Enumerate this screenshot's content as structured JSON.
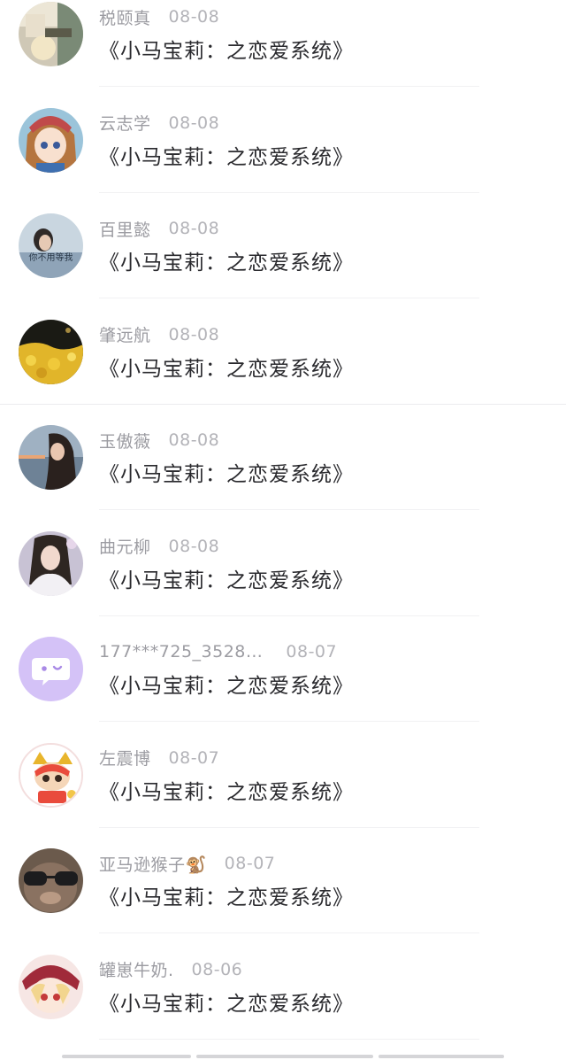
{
  "comments": [
    {
      "name": "税颐真",
      "date": "08-08",
      "content": "《小马宝莉：之恋爱系统》"
    },
    {
      "name": "云志学",
      "date": "08-08",
      "content": "《小马宝莉：之恋爱系统》"
    },
    {
      "name": "百里懿",
      "date": "08-08",
      "content": "《小马宝莉：之恋爱系统》"
    },
    {
      "name": "肇远航",
      "date": "08-08",
      "content": "《小马宝莉：之恋爱系统》"
    },
    {
      "name": "玉傲薇",
      "date": "08-08",
      "content": "《小马宝莉：之恋爱系统》"
    },
    {
      "name": "曲元柳",
      "date": "08-08",
      "content": "《小马宝莉：之恋爱系统》"
    },
    {
      "name": "177***725_3528…",
      "date": "08-07",
      "content": "《小马宝莉：之恋爱系统》"
    },
    {
      "name": "左震博",
      "date": "08-07",
      "content": "《小马宝莉：之恋爱系统》"
    },
    {
      "name": "亚马逊猴子🐒",
      "date": "08-07",
      "content": "《小马宝莉：之恋爱系统》"
    },
    {
      "name": "罐崽牛奶.",
      "date": "08-06",
      "content": "《小马宝莉：之恋爱系统》"
    }
  ],
  "avatar_text": "你不用等我",
  "colors": {
    "name": "#9c9ca2",
    "date": "#b3b3b8",
    "content": "#2a2a2e",
    "divider": "#f1f1f3",
    "default_avatar": "#d4c2f7"
  }
}
